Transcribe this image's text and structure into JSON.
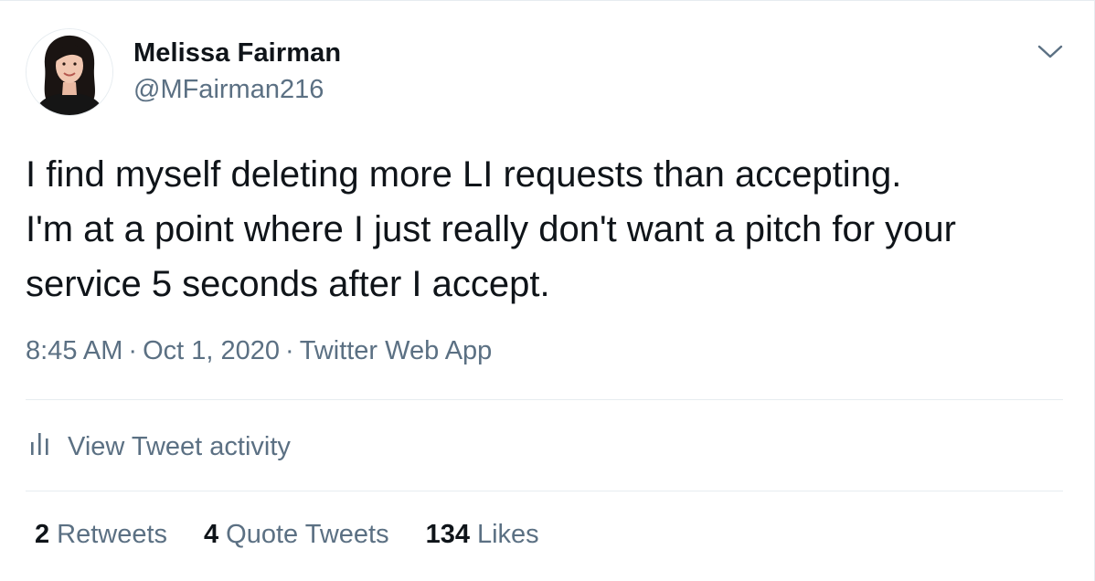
{
  "tweet": {
    "author": {
      "name": "Melissa Fairman",
      "handle": "@MFairman216"
    },
    "text_lines": [
      "I find myself deleting more LI requests than accepting.",
      "I'm at a point where I just really don't want a pitch for your",
      "service 5 seconds after I accept."
    ],
    "time": "8:45 AM",
    "date": "Oct 1, 2020",
    "source": "Twitter Web App",
    "separator": "·",
    "activity_label": "View Tweet activity",
    "stats": {
      "retweets": {
        "count": "2",
        "label": "Retweets"
      },
      "quote_tweets": {
        "count": "4",
        "label": "Quote Tweets"
      },
      "likes": {
        "count": "134",
        "label": "Likes"
      }
    }
  },
  "icons": {
    "menu": "chevron-down-icon",
    "activity": "bar-chart-icon"
  },
  "colors": {
    "primary_text": "#0f1419",
    "secondary_text": "#5b7083",
    "divider": "#e6ecf0"
  }
}
